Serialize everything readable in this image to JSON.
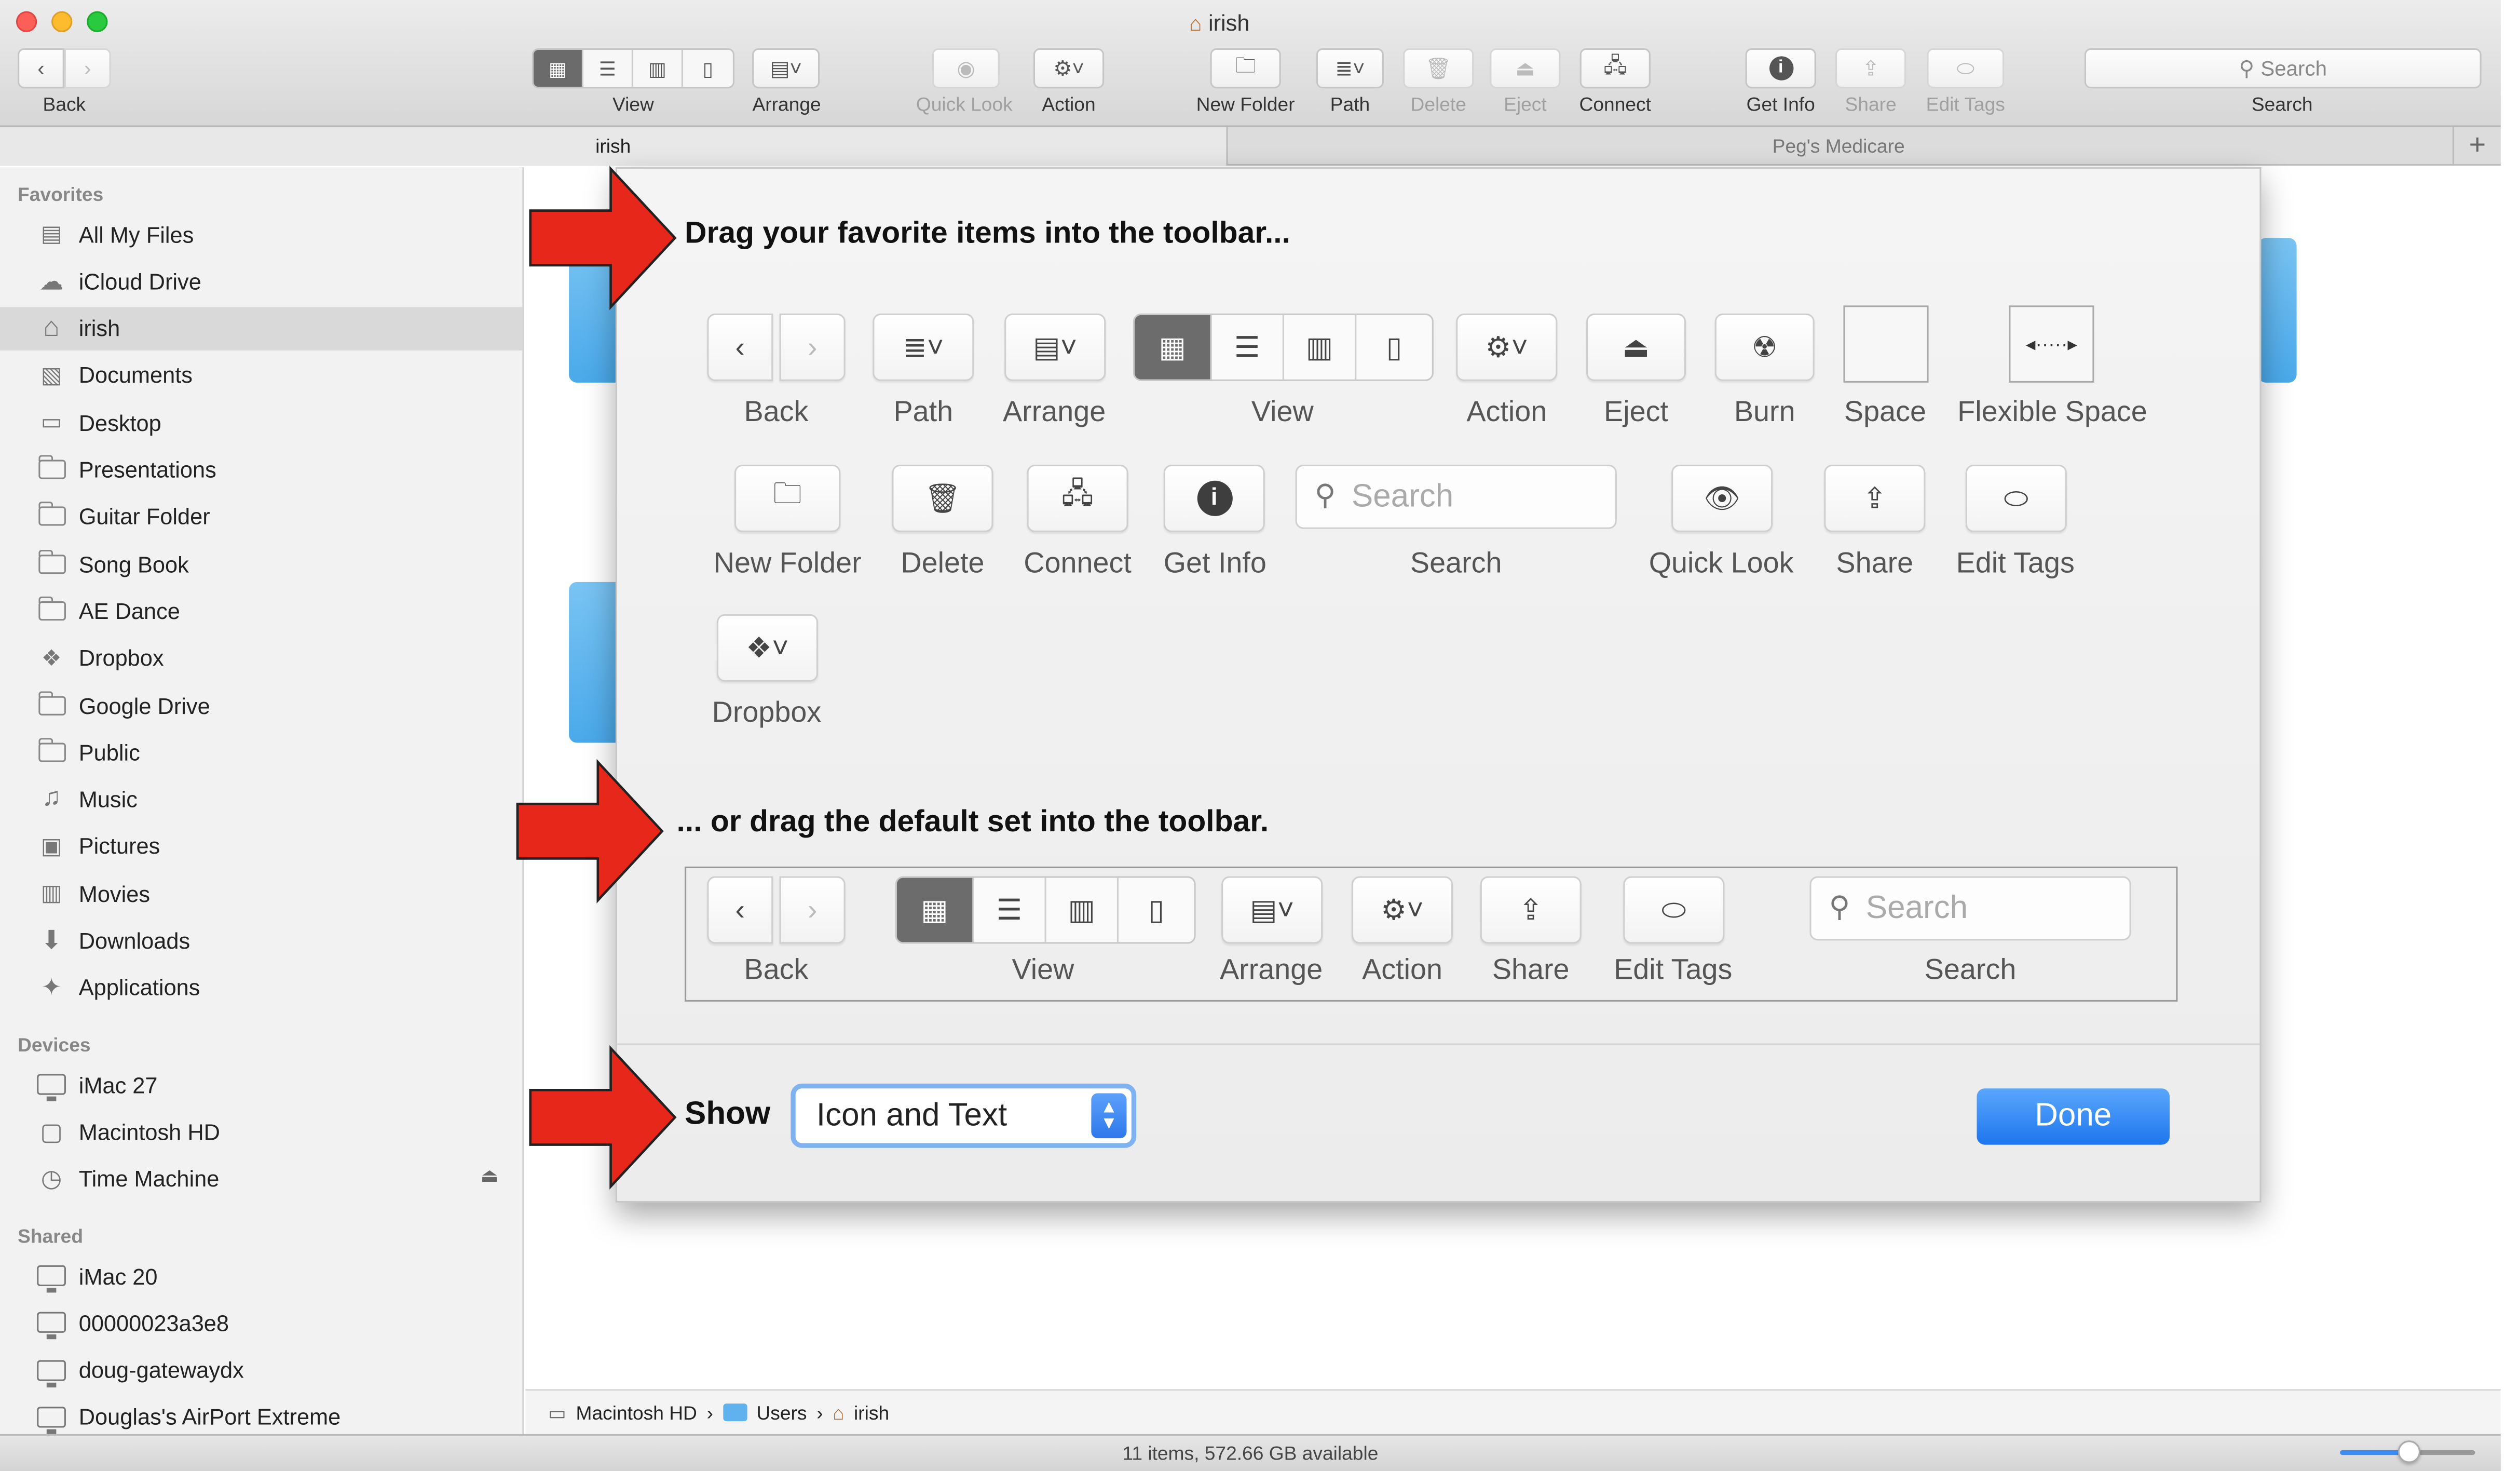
{
  "window": {
    "title": "irish",
    "toolbar": {
      "back_label": "Back",
      "view_label": "View",
      "arrange_label": "Arrange",
      "quicklook_label": "Quick Look",
      "action_label": "Action",
      "newfolder_label": "New Folder",
      "path_label": "Path",
      "delete_label": "Delete",
      "eject_label": "Eject",
      "connect_label": "Connect",
      "getinfo_label": "Get Info",
      "share_label": "Share",
      "edittags_label": "Edit Tags",
      "search_placeholder": "Search",
      "search_label": "Search"
    },
    "tabs": [
      "irish",
      "Peg's Medicare"
    ]
  },
  "sidebar": {
    "favorites_header": "Favorites",
    "favorites": [
      {
        "label": "All My Files",
        "icon": "all-files-icon"
      },
      {
        "label": "iCloud Drive",
        "icon": "cloud-icon"
      },
      {
        "label": "irish",
        "icon": "home-icon",
        "selected": true
      },
      {
        "label": "Documents",
        "icon": "documents-icon"
      },
      {
        "label": "Desktop",
        "icon": "desktop-icon"
      },
      {
        "label": "Presentations",
        "icon": "folder-icon"
      },
      {
        "label": "Guitar Folder",
        "icon": "folder-icon"
      },
      {
        "label": "Song Book",
        "icon": "folder-icon"
      },
      {
        "label": "AE Dance",
        "icon": "folder-icon"
      },
      {
        "label": "Dropbox",
        "icon": "dropbox-icon"
      },
      {
        "label": "Google Drive",
        "icon": "folder-icon"
      },
      {
        "label": "Public",
        "icon": "folder-icon"
      },
      {
        "label": "Music",
        "icon": "music-icon"
      },
      {
        "label": "Pictures",
        "icon": "pictures-icon"
      },
      {
        "label": "Movies",
        "icon": "movies-icon"
      },
      {
        "label": "Downloads",
        "icon": "downloads-icon"
      },
      {
        "label": "Applications",
        "icon": "applications-icon"
      }
    ],
    "devices_header": "Devices",
    "devices": [
      {
        "label": "iMac 27",
        "icon": "imac-icon"
      },
      {
        "label": "Macintosh HD",
        "icon": "disk-icon"
      },
      {
        "label": "Time Machine",
        "icon": "time-machine-icon"
      }
    ],
    "shared_header": "Shared",
    "shared": [
      {
        "label": "iMac 20",
        "icon": "imac-icon"
      },
      {
        "label": "00000023a3e8",
        "icon": "monitor-icon"
      },
      {
        "label": "doug-gatewaydx",
        "icon": "monitor-icon"
      },
      {
        "label": "Douglas's AirPort Extreme",
        "icon": "monitor-icon"
      }
    ]
  },
  "customize": {
    "heading_favorites": "Drag your favorite items into the toolbar...",
    "items": {
      "back": "Back",
      "path": "Path",
      "arrange": "Arrange",
      "view": "View",
      "action": "Action",
      "eject": "Eject",
      "burn": "Burn",
      "space": "Space",
      "flexible_space": "Flexible Space",
      "new_folder": "New Folder",
      "delete": "Delete",
      "connect": "Connect",
      "get_info": "Get Info",
      "search": "Search",
      "search_placeholder": "Search",
      "quick_look": "Quick Look",
      "share": "Share",
      "edit_tags": "Edit Tags",
      "dropbox": "Dropbox"
    },
    "heading_default": "... or drag the default set into the toolbar.",
    "default_set": {
      "back": "Back",
      "view": "View",
      "arrange": "Arrange",
      "action": "Action",
      "share": "Share",
      "edit_tags": "Edit Tags",
      "search": "Search",
      "search_placeholder": "Search"
    },
    "show_label": "Show",
    "show_value": "Icon and Text",
    "done_label": "Done"
  },
  "pathbar": {
    "crumbs": [
      "Macintosh HD",
      "Users",
      "irish"
    ],
    "separator": "›"
  },
  "status": {
    "text": "11 items, 572.66 GB available"
  },
  "colors": {
    "arrow": "#e8271b",
    "done_button": "#2f80f0",
    "selection_highlight": "#7fb2f0"
  }
}
